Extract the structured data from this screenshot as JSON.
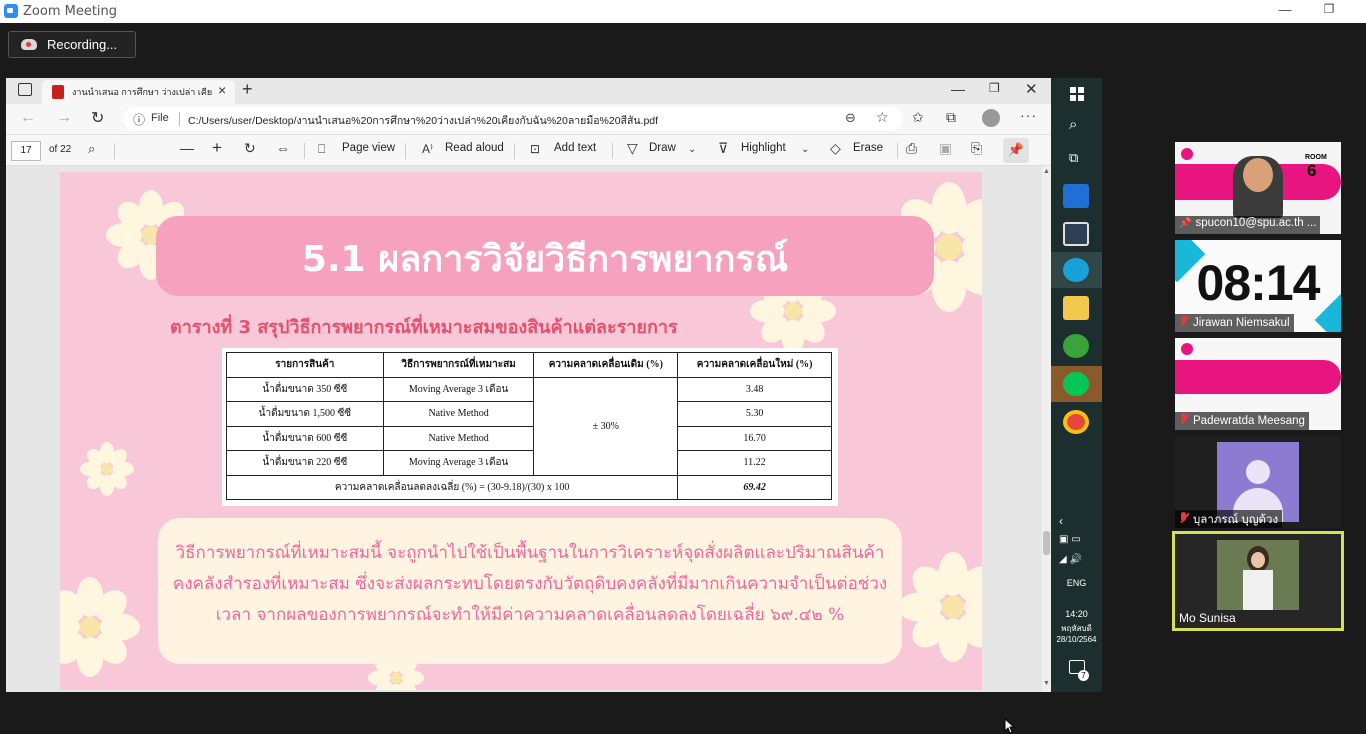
{
  "zoom": {
    "title": "Zoom Meeting",
    "recording_label": "Recording..."
  },
  "browser": {
    "tab_title": "งานนำเสนอ การศึกษา ว่างเปล่า เคียง…",
    "url_prefix": "File",
    "url": "C:/Users/user/Desktop/งานนำเสนอ%20การศึกษา%20ว่างเปล่า%20เคียงกับฉัน%20ลายมือ%20สีสัน.pdf"
  },
  "pdf_toolbar": {
    "page_number": "17",
    "page_total": "of 22",
    "page_view": "Page view",
    "read_aloud": "Read aloud",
    "add_text": "Add text",
    "draw": "Draw",
    "highlight": "Highlight",
    "erase": "Erase"
  },
  "slide": {
    "title": "5.1 ผลการวิจัยวิธีการพยากรณ์",
    "subtitle": "ตารางที่ 3 สรุปวิธีการพยากรณ์ที่เหมาะสมของสินค้าแต่ละรายการ",
    "table": {
      "headers": [
        "รายการสินค้า",
        "วิธีการพยากรณ์ที่เหมาะสม",
        "ความคลาดเคลื่อนเดิม (%)",
        "ความคลาดเคลื่อนใหม่ (%)"
      ],
      "rows": [
        {
          "item": "น้ำดื่มขนาด 350 ซีซี",
          "method": "Moving Average 3 เดือน",
          "new": "3.48"
        },
        {
          "item": "น้ำดื่มขนาด 1,500 ซีซี",
          "method": "Native Method",
          "new": "5.30"
        },
        {
          "item": "น้ำดื่มขนาด 600 ซีซี",
          "method": "Native Method",
          "new": "16.70"
        },
        {
          "item": "น้ำดื่มขนาด 220 ซีซี",
          "method": "Moving Average 3 เดือน",
          "new": "11.22"
        }
      ],
      "old_error": "± 30%",
      "footer_label": "ความคลาดเคลื่อนลดลงเฉลี่ย (%) = (30-9.18)/(30) x 100",
      "footer_value": "69.42"
    },
    "note_lines": [
      "วิธีการพยากรณ์ที่เหมาะสมนี้ จะถูกนำไปใช้เป็นพื้นฐานในการวิเคราะห์จุดสั่งผลิตและปริมาณสินค้า",
      "คงคลังสำรองที่เหมาะสม ซึ่งจะส่งผลกระทบโดยตรงกับวัตถุดิบคงคลังที่มีมากเกินความจำเป็นต่อช่วง",
      "เวลา จากผลของการพยากรณ์จะทำให้มีค่าความคลาดเคลื่อนลดลงโดยเฉลี่ย ๖๙.๔๒ %"
    ]
  },
  "taskbar": {
    "language": "ENG",
    "time": "14:20",
    "day": "พฤหัสบดี",
    "date": "28/10/2564",
    "notification_count": "7"
  },
  "participants": [
    {
      "name": "spucon10@spu.ac.th ...",
      "room_label": "ROOM",
      "room_number": "6"
    },
    {
      "name": "Jirawan Niemsakul",
      "clock": "08:14"
    },
    {
      "name": "Padewratda Meesang"
    },
    {
      "name": "บุลาภรณ์ บุญด้วง"
    },
    {
      "name": "Mo Sunisa"
    }
  ],
  "colors": {
    "slide_bg": "#f9c8d8",
    "banner": "#f6a1bd",
    "subtitle": "#e5506e",
    "note_text": "#f0679c",
    "active_speaker_border": "#d4e157"
  }
}
